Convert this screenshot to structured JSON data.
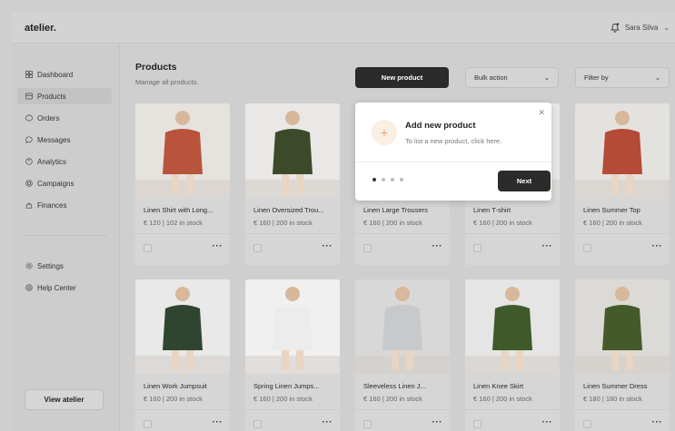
{
  "app": {
    "logo": "atelier."
  },
  "user": {
    "name": "Sara Silva"
  },
  "sidebar": {
    "items": [
      {
        "label": "Dashboard",
        "icon": "dashboard-icon"
      },
      {
        "label": "Products",
        "icon": "products-icon",
        "active": true
      },
      {
        "label": "Orders",
        "icon": "orders-icon"
      },
      {
        "label": "Messages",
        "icon": "messages-icon"
      },
      {
        "label": "Analytics",
        "icon": "analytics-icon"
      },
      {
        "label": "Campaigns",
        "icon": "campaigns-icon"
      },
      {
        "label": "Finances",
        "icon": "finances-icon"
      }
    ],
    "secondary": [
      {
        "label": "Settings",
        "icon": "settings-icon"
      },
      {
        "label": "Help Center",
        "icon": "help-icon"
      }
    ],
    "view_button": "View atelier"
  },
  "page": {
    "title": "Products",
    "subtitle": "Manage all products."
  },
  "toolbar": {
    "new_product": "New product",
    "bulk_action": "Bulk action",
    "filter_by": "Filter by"
  },
  "popup": {
    "title": "Add new product",
    "description": "To list a new product, click here.",
    "next": "Next",
    "steps": 4,
    "current_step": 1
  },
  "products": [
    {
      "name": "Linen Shirt with Long...",
      "meta": "€ 120  |  102 in stock",
      "color": "#b8543c"
    },
    {
      "name": "Linen Oversized Trou...",
      "meta": "€ 160  |  200 in stock",
      "color": "#3d4a2a"
    },
    {
      "name": "Linen Large Trousers",
      "meta": "€ 160  |  200 in stock",
      "color": "#9b9b9b"
    },
    {
      "name": "Linen T-shirt",
      "meta": "€ 160  |  200 in stock",
      "color": "#c9c9c9"
    },
    {
      "name": "Linen Summer Top",
      "meta": "€ 160  |  200 in stock",
      "color": "#b54b36"
    },
    {
      "name": "Linen Work Jumpsuit",
      "meta": "€ 160  |  200 in stock",
      "color": "#2f4530"
    },
    {
      "name": "Spring Linen Jumps...",
      "meta": "€ 160  |  200 in stock",
      "color": "#ececec"
    },
    {
      "name": "Sleeveless Linen J...",
      "meta": "€ 160  |  200 in stock",
      "color": "#c7c9cb"
    },
    {
      "name": "Linen Knee Skirt",
      "meta": "€ 160  |  200 in stock",
      "color": "#3e5a2b"
    },
    {
      "name": "Linen Summer Dress",
      "meta": "€ 180  |  180 in stock",
      "color": "#455a2a"
    }
  ]
}
